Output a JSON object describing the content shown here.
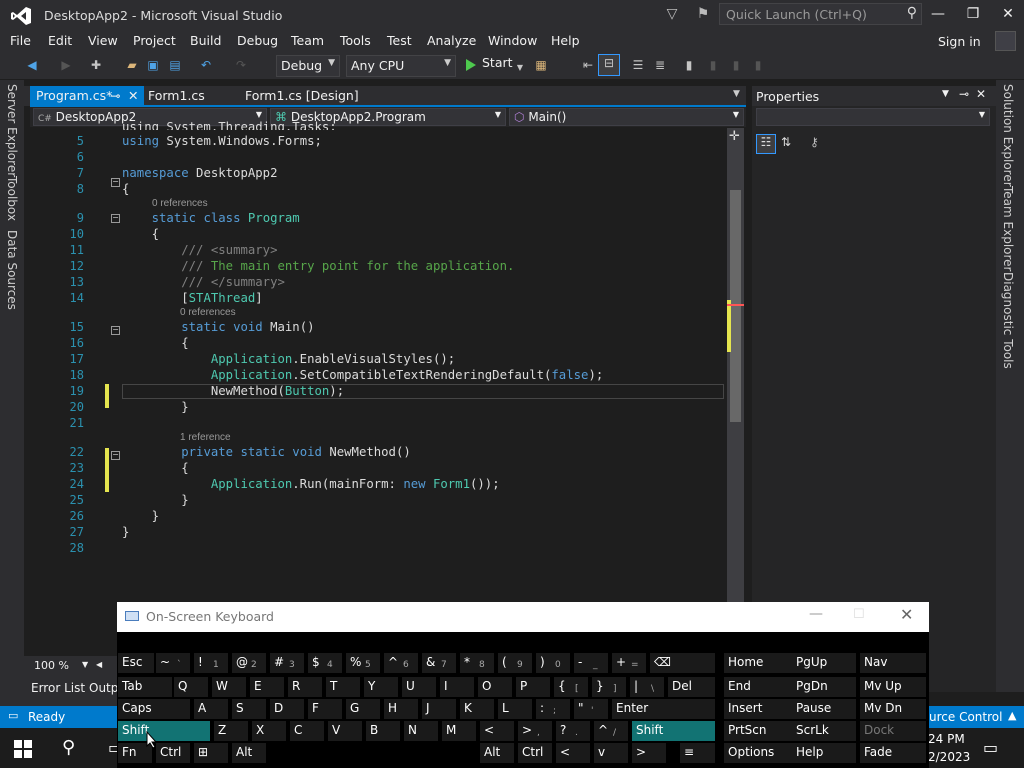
{
  "window": {
    "title": "DesktopApp2 - Microsoft Visual Studio"
  },
  "quick_launch": {
    "placeholder": "Quick Launch (Ctrl+Q)"
  },
  "menu": [
    "File",
    "Edit",
    "View",
    "Project",
    "Build",
    "Debug",
    "Team",
    "Tools",
    "Test",
    "Analyze",
    "Window",
    "Help"
  ],
  "sign_in": "Sign in",
  "toolbar": {
    "config": "Debug",
    "platform": "Any CPU",
    "start_label": "Start"
  },
  "left_rail": [
    "Server Explorer",
    "Toolbox",
    "Data Sources"
  ],
  "right_rail": [
    "Solution Explorer",
    "Team Explorer",
    "Diagnostic Tools"
  ],
  "tabs": [
    {
      "label": "Program.cs*",
      "active": true
    },
    {
      "label": "Form1.cs",
      "active": false
    },
    {
      "label": "Form1.cs [Design]",
      "active": false
    }
  ],
  "nav": {
    "project": "DesktopApp2",
    "class": "DesktopApp2.Program",
    "member": "Main()"
  },
  "code": {
    "partial_line": "using System.Threading.Tasks;",
    "lines": [
      {
        "n": "5",
        "text": "using System.Windows.Forms;"
      },
      {
        "n": "6",
        "text": ""
      },
      {
        "n": "7",
        "text": "namespace DesktopApp2"
      },
      {
        "n": "8",
        "text": "{"
      },
      {
        "n": "9",
        "text": "    static class Program"
      },
      {
        "n": "10",
        "text": "    {"
      },
      {
        "n": "11",
        "text": "        /// <summary>"
      },
      {
        "n": "12",
        "text": "        /// The main entry point for the application."
      },
      {
        "n": "13",
        "text": "        /// </summary>"
      },
      {
        "n": "14",
        "text": "        [STAThread]"
      },
      {
        "n": "15",
        "text": "        static void Main()"
      },
      {
        "n": "16",
        "text": "        {"
      },
      {
        "n": "17",
        "text": "            Application.EnableVisualStyles();"
      },
      {
        "n": "18",
        "text": "            Application.SetCompatibleTextRenderingDefault(false);"
      },
      {
        "n": "19",
        "text": "            NewMethod(Button);"
      },
      {
        "n": "20",
        "text": "        }"
      },
      {
        "n": "21",
        "text": ""
      },
      {
        "n": "22",
        "text": "        private static void NewMethod()"
      },
      {
        "n": "23",
        "text": "        {"
      },
      {
        "n": "24",
        "text": "            Application.Run(mainForm: new Form1());"
      },
      {
        "n": "25",
        "text": "        }"
      },
      {
        "n": "26",
        "text": "    }"
      },
      {
        "n": "27",
        "text": "}"
      },
      {
        "n": "28",
        "text": ""
      }
    ],
    "refs": {
      "class": "0 references",
      "main": "0 references",
      "newmethod": "1 reference"
    }
  },
  "properties": {
    "title": "Properties"
  },
  "zoom": "100 %",
  "bottom_tabs": [
    "Error List",
    "Outp"
  ],
  "status": {
    "left": "Ready",
    "right": "urce Control"
  },
  "osk": {
    "title": "On-Screen Keyboard",
    "rows": [
      [
        "Esc",
        "~",
        "!",
        "@",
        "#",
        "$",
        "%",
        "^",
        "&",
        "*",
        "(",
        ")",
        "-",
        "+",
        "⌫"
      ],
      [
        "Tab",
        "Q",
        "W",
        "E",
        "R",
        "T",
        "Y",
        "U",
        "I",
        "O",
        "P",
        "{",
        "}",
        "|",
        "Del"
      ],
      [
        "Caps",
        "A",
        "S",
        "D",
        "F",
        "G",
        "H",
        "J",
        "K",
        "L",
        ":",
        "\"",
        "Enter"
      ],
      [
        "Shift",
        "Z",
        "X",
        "C",
        "V",
        "B",
        "N",
        "M",
        "<",
        ">",
        "?",
        "^",
        "Shift"
      ],
      [
        "Fn",
        "Ctrl",
        "⊞",
        "Alt",
        "Alt",
        "Ctrl",
        "<",
        "v",
        ">",
        "≡"
      ]
    ],
    "subs": {
      "row0": [
        "`",
        "1",
        "2",
        "3",
        "4",
        "5",
        "6",
        "7",
        "8",
        "9",
        "0",
        "_",
        "="
      ],
      "row1": [
        "[",
        "]",
        "\\"
      ],
      "row2": [
        ";",
        "'"
      ],
      "row3": [
        ",",
        ".",
        "/"
      ]
    },
    "side": [
      [
        "Home",
        "PgUp",
        "Nav"
      ],
      [
        "End",
        "PgDn",
        "Mv Up"
      ],
      [
        "Insert",
        "Pause",
        "Mv Dn"
      ],
      [
        "PrtScn",
        "ScrLk",
        "Dock"
      ],
      [
        "Options",
        "Help",
        "Fade"
      ]
    ]
  },
  "clock": {
    "time": "24 PM",
    "date": "2/2023"
  }
}
